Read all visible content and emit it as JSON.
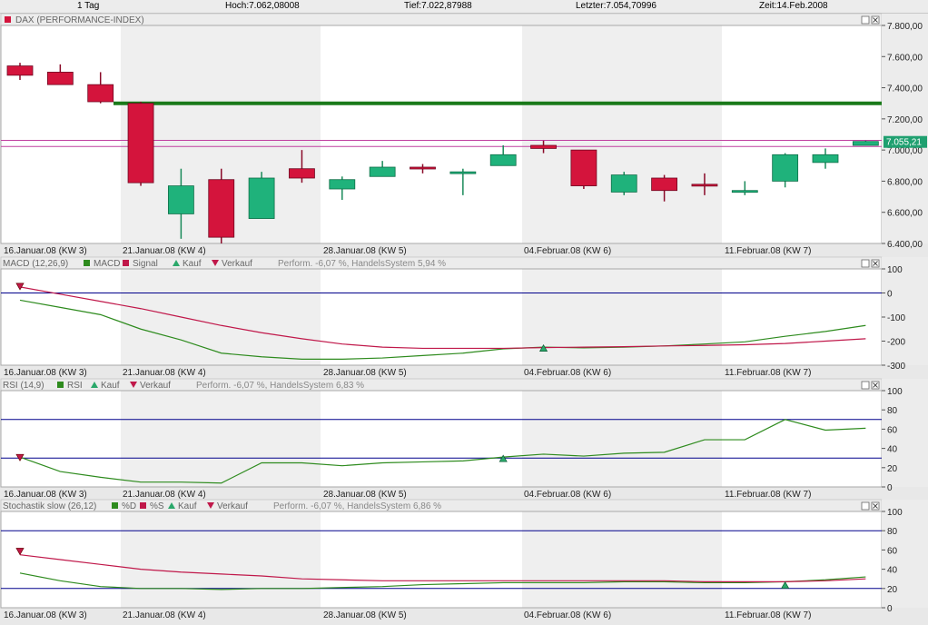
{
  "header": {
    "period": "1 Tag",
    "high": "Hoch:7.062,08008",
    "low": "Tief:7.022,87988",
    "last": "Letzter:7.054,70996",
    "time": "Zeit:14.Feb.2008"
  },
  "colors": {
    "up": "#1fb27b",
    "down": "#d4143c",
    "macd_line": "#2e8b1e",
    "signal_line": "#c0184a",
    "ref_line": "#00008b",
    "resistance": "#1a7a1a",
    "price_band": "#c040a0"
  },
  "date_labels": [
    "16.Januar.08 (KW 3)",
    "21.Januar.08 (KW 4)",
    "28.Januar.08 (KW 5)",
    "04.Februar.08 (KW 6)",
    "11.Februar.08 (KW 7)"
  ],
  "panels": {
    "price": {
      "title": "DAX (PERFORMANCE-INDEX)",
      "last_label": "7.055,21"
    },
    "macd": {
      "title": "MACD (12,26,9)",
      "legend": [
        "MACD",
        "Signal",
        "Kauf",
        "Verkauf"
      ],
      "perf": "Perform. -6,07 %, HandelsSystem 5,94 %"
    },
    "rsi": {
      "title": "RSI (14,9)",
      "legend": [
        "RSI",
        "Kauf",
        "Verkauf"
      ],
      "perf": "Perform. -6,07 %, HandelsSystem 6,83 %"
    },
    "stoch": {
      "title": "Stochastik slow (26,12)",
      "legend": [
        "%D",
        "%S",
        "Kauf",
        "Verkauf"
      ],
      "perf": "Perform. -6,07 %, HandelsSystem 6,86 %"
    }
  },
  "chart_data": [
    {
      "type": "candlestick",
      "title": "DAX (PERFORMANCE-INDEX)",
      "ylim": [
        6400,
        7800
      ],
      "yticks": [
        "6.400,00",
        "6.600,00",
        "6.800,00",
        "7.000,00",
        "7.200,00",
        "7.400,00",
        "7.600,00",
        "7.800,00"
      ],
      "candles": [
        {
          "o": 7540,
          "h": 7560,
          "l": 7450,
          "c": 7480
        },
        {
          "o": 7500,
          "h": 7550,
          "l": 7420,
          "c": 7420
        },
        {
          "o": 7420,
          "h": 7500,
          "l": 7300,
          "c": 7310
        },
        {
          "o": 7300,
          "h": 7310,
          "l": 6770,
          "c": 6790
        },
        {
          "o": 6590,
          "h": 6880,
          "l": 6430,
          "c": 6770
        },
        {
          "o": 6810,
          "h": 6880,
          "l": 6400,
          "c": 6440
        },
        {
          "o": 6560,
          "h": 6860,
          "l": 6560,
          "c": 6820
        },
        {
          "o": 6880,
          "h": 7000,
          "l": 6790,
          "c": 6820
        },
        {
          "o": 6750,
          "h": 6830,
          "l": 6680,
          "c": 6810
        },
        {
          "o": 6830,
          "h": 6930,
          "l": 6830,
          "c": 6890
        },
        {
          "o": 6890,
          "h": 6910,
          "l": 6850,
          "c": 6880
        },
        {
          "o": 6860,
          "h": 6880,
          "l": 6710,
          "c": 6860
        },
        {
          "o": 6900,
          "h": 7030,
          "l": 6900,
          "c": 6970
        },
        {
          "o": 7030,
          "h": 7060,
          "l": 6980,
          "c": 7010
        },
        {
          "o": 7000,
          "h": 7000,
          "l": 6750,
          "c": 6770
        },
        {
          "o": 6730,
          "h": 6860,
          "l": 6710,
          "c": 6840
        },
        {
          "o": 6820,
          "h": 6840,
          "l": 6670,
          "c": 6740
        },
        {
          "o": 6780,
          "h": 6850,
          "l": 6710,
          "c": 6770
        },
        {
          "o": 6730,
          "h": 6800,
          "l": 6710,
          "c": 6740
        },
        {
          "o": 6800,
          "h": 6980,
          "l": 6760,
          "c": 6970
        },
        {
          "o": 6920,
          "h": 7010,
          "l": 6880,
          "c": 6970
        },
        {
          "o": 7030,
          "h": 7060,
          "l": 7030,
          "c": 7055
        }
      ],
      "lines": {
        "resistance": 7300,
        "band_high": 7062,
        "band_low": 7023
      },
      "last_value": "7.055,21"
    },
    {
      "type": "line",
      "title": "MACD (12,26,9)",
      "ylim": [
        -300,
        100
      ],
      "yticks": [
        "-300",
        "-200",
        "-100",
        "0",
        "100"
      ],
      "series": [
        {
          "name": "MACD",
          "values": [
            -30,
            -60,
            -90,
            -150,
            -195,
            -250,
            -265,
            -275,
            -275,
            -270,
            -260,
            -250,
            -232,
            -225,
            -228,
            -225,
            -220,
            -212,
            -203,
            -180,
            -160,
            -135
          ]
        },
        {
          "name": "Signal",
          "values": [
            25,
            -5,
            -35,
            -65,
            -100,
            -135,
            -165,
            -190,
            -212,
            -225,
            -230,
            -230,
            -230,
            -227,
            -225,
            -223,
            -220,
            -218,
            -215,
            -210,
            -200,
            -190
          ]
        }
      ],
      "signals": [
        {
          "type": "Verkauf",
          "index": 0,
          "value": 25
        },
        {
          "type": "Kauf",
          "index": 13,
          "value": -227
        }
      ],
      "hline": 0
    },
    {
      "type": "line",
      "title": "RSI (14,9)",
      "ylim": [
        0,
        100
      ],
      "yticks": [
        "0",
        "20",
        "40",
        "60",
        "80",
        "100"
      ],
      "series": [
        {
          "name": "RSI",
          "values": [
            31,
            16,
            10,
            5,
            5,
            4,
            25,
            25,
            22,
            25,
            26,
            27,
            31,
            34,
            32,
            35,
            36,
            49,
            49,
            70,
            59,
            61
          ]
        }
      ],
      "signals": [
        {
          "type": "Verkauf",
          "index": 0,
          "value": 30
        },
        {
          "type": "Kauf",
          "index": 12,
          "value": 30
        }
      ],
      "hlines": [
        30,
        70
      ]
    },
    {
      "type": "line",
      "title": "Stochastik slow (26,12)",
      "ylim": [
        0,
        100
      ],
      "yticks": [
        "0",
        "20",
        "40",
        "60",
        "80",
        "100"
      ],
      "series": [
        {
          "name": "%D",
          "values": [
            36,
            28,
            22,
            20,
            20,
            19,
            20,
            20,
            21,
            22,
            24,
            25,
            26,
            26,
            26,
            27,
            27,
            26,
            26,
            27,
            29,
            32
          ]
        },
        {
          "name": "%S",
          "values": [
            55,
            50,
            45,
            40,
            37,
            35,
            33,
            30,
            29,
            28,
            28,
            28,
            28,
            28,
            28,
            28,
            28,
            27,
            27,
            27,
            28,
            30
          ]
        }
      ],
      "signals": [
        {
          "type": "Verkauf",
          "index": 0,
          "value": 58
        },
        {
          "type": "Kauf",
          "index": 19,
          "value": 24
        }
      ],
      "hlines": [
        20,
        80
      ]
    }
  ]
}
